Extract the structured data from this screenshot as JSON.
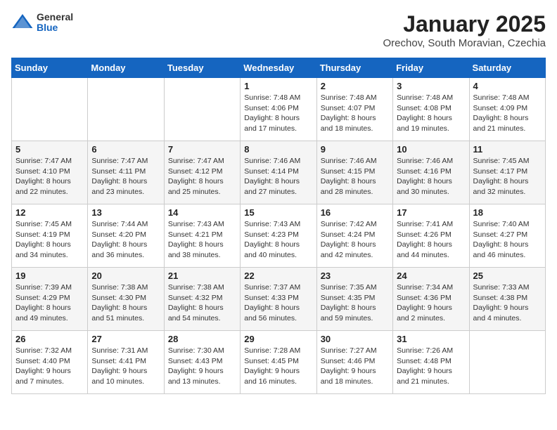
{
  "header": {
    "logo_general": "General",
    "logo_blue": "Blue",
    "title": "January 2025",
    "subtitle": "Orechov, South Moravian, Czechia"
  },
  "days_of_week": [
    "Sunday",
    "Monday",
    "Tuesday",
    "Wednesday",
    "Thursday",
    "Friday",
    "Saturday"
  ],
  "weeks": [
    [
      {
        "day": "",
        "info": ""
      },
      {
        "day": "",
        "info": ""
      },
      {
        "day": "",
        "info": ""
      },
      {
        "day": "1",
        "info": "Sunrise: 7:48 AM\nSunset: 4:06 PM\nDaylight: 8 hours and 17 minutes."
      },
      {
        "day": "2",
        "info": "Sunrise: 7:48 AM\nSunset: 4:07 PM\nDaylight: 8 hours and 18 minutes."
      },
      {
        "day": "3",
        "info": "Sunrise: 7:48 AM\nSunset: 4:08 PM\nDaylight: 8 hours and 19 minutes."
      },
      {
        "day": "4",
        "info": "Sunrise: 7:48 AM\nSunset: 4:09 PM\nDaylight: 8 hours and 21 minutes."
      }
    ],
    [
      {
        "day": "5",
        "info": "Sunrise: 7:47 AM\nSunset: 4:10 PM\nDaylight: 8 hours and 22 minutes."
      },
      {
        "day": "6",
        "info": "Sunrise: 7:47 AM\nSunset: 4:11 PM\nDaylight: 8 hours and 23 minutes."
      },
      {
        "day": "7",
        "info": "Sunrise: 7:47 AM\nSunset: 4:12 PM\nDaylight: 8 hours and 25 minutes."
      },
      {
        "day": "8",
        "info": "Sunrise: 7:46 AM\nSunset: 4:14 PM\nDaylight: 8 hours and 27 minutes."
      },
      {
        "day": "9",
        "info": "Sunrise: 7:46 AM\nSunset: 4:15 PM\nDaylight: 8 hours and 28 minutes."
      },
      {
        "day": "10",
        "info": "Sunrise: 7:46 AM\nSunset: 4:16 PM\nDaylight: 8 hours and 30 minutes."
      },
      {
        "day": "11",
        "info": "Sunrise: 7:45 AM\nSunset: 4:17 PM\nDaylight: 8 hours and 32 minutes."
      }
    ],
    [
      {
        "day": "12",
        "info": "Sunrise: 7:45 AM\nSunset: 4:19 PM\nDaylight: 8 hours and 34 minutes."
      },
      {
        "day": "13",
        "info": "Sunrise: 7:44 AM\nSunset: 4:20 PM\nDaylight: 8 hours and 36 minutes."
      },
      {
        "day": "14",
        "info": "Sunrise: 7:43 AM\nSunset: 4:21 PM\nDaylight: 8 hours and 38 minutes."
      },
      {
        "day": "15",
        "info": "Sunrise: 7:43 AM\nSunset: 4:23 PM\nDaylight: 8 hours and 40 minutes."
      },
      {
        "day": "16",
        "info": "Sunrise: 7:42 AM\nSunset: 4:24 PM\nDaylight: 8 hours and 42 minutes."
      },
      {
        "day": "17",
        "info": "Sunrise: 7:41 AM\nSunset: 4:26 PM\nDaylight: 8 hours and 44 minutes."
      },
      {
        "day": "18",
        "info": "Sunrise: 7:40 AM\nSunset: 4:27 PM\nDaylight: 8 hours and 46 minutes."
      }
    ],
    [
      {
        "day": "19",
        "info": "Sunrise: 7:39 AM\nSunset: 4:29 PM\nDaylight: 8 hours and 49 minutes."
      },
      {
        "day": "20",
        "info": "Sunrise: 7:38 AM\nSunset: 4:30 PM\nDaylight: 8 hours and 51 minutes."
      },
      {
        "day": "21",
        "info": "Sunrise: 7:38 AM\nSunset: 4:32 PM\nDaylight: 8 hours and 54 minutes."
      },
      {
        "day": "22",
        "info": "Sunrise: 7:37 AM\nSunset: 4:33 PM\nDaylight: 8 hours and 56 minutes."
      },
      {
        "day": "23",
        "info": "Sunrise: 7:35 AM\nSunset: 4:35 PM\nDaylight: 8 hours and 59 minutes."
      },
      {
        "day": "24",
        "info": "Sunrise: 7:34 AM\nSunset: 4:36 PM\nDaylight: 9 hours and 2 minutes."
      },
      {
        "day": "25",
        "info": "Sunrise: 7:33 AM\nSunset: 4:38 PM\nDaylight: 9 hours and 4 minutes."
      }
    ],
    [
      {
        "day": "26",
        "info": "Sunrise: 7:32 AM\nSunset: 4:40 PM\nDaylight: 9 hours and 7 minutes."
      },
      {
        "day": "27",
        "info": "Sunrise: 7:31 AM\nSunset: 4:41 PM\nDaylight: 9 hours and 10 minutes."
      },
      {
        "day": "28",
        "info": "Sunrise: 7:30 AM\nSunset: 4:43 PM\nDaylight: 9 hours and 13 minutes."
      },
      {
        "day": "29",
        "info": "Sunrise: 7:28 AM\nSunset: 4:45 PM\nDaylight: 9 hours and 16 minutes."
      },
      {
        "day": "30",
        "info": "Sunrise: 7:27 AM\nSunset: 4:46 PM\nDaylight: 9 hours and 18 minutes."
      },
      {
        "day": "31",
        "info": "Sunrise: 7:26 AM\nSunset: 4:48 PM\nDaylight: 9 hours and 21 minutes."
      },
      {
        "day": "",
        "info": ""
      }
    ]
  ]
}
